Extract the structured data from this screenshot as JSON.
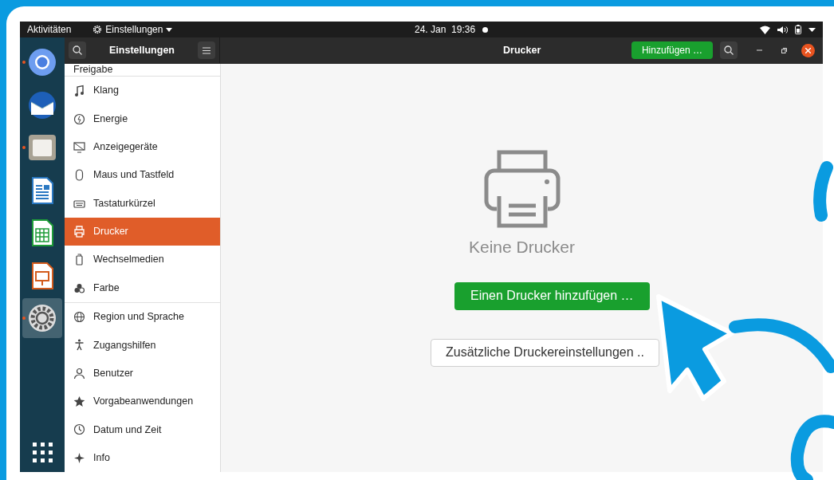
{
  "top_bar": {
    "activities": "Aktivitäten",
    "app_menu": "Einstellungen",
    "clock": "24. Jan  19:36",
    "notification": true
  },
  "dock": [
    {
      "kind": "browser",
      "running": true,
      "selected": false
    },
    {
      "kind": "mail",
      "running": false,
      "selected": false
    },
    {
      "kind": "files",
      "running": true,
      "selected": false
    },
    {
      "kind": "writer",
      "running": false,
      "selected": false
    },
    {
      "kind": "calc",
      "running": false,
      "selected": false
    },
    {
      "kind": "impress",
      "running": false,
      "selected": false
    },
    {
      "kind": "settings",
      "running": true,
      "selected": true
    }
  ],
  "header": {
    "sidebar_title": "Einstellungen",
    "page_title": "Drucker",
    "add_button": "Hinzufügen …"
  },
  "sidebar": {
    "groups": [
      [
        {
          "label": "Freigabe",
          "selected": false
        }
      ],
      [
        {
          "label": "Klang",
          "selected": false
        },
        {
          "label": "Energie",
          "selected": false
        },
        {
          "label": "Anzeigegeräte",
          "selected": false
        },
        {
          "label": "Maus und Tastfeld",
          "selected": false
        },
        {
          "label": "Tastaturkürzel",
          "selected": false
        },
        {
          "label": "Drucker",
          "selected": true
        },
        {
          "label": "Wechselmedien",
          "selected": false
        },
        {
          "label": "Farbe",
          "selected": false
        }
      ],
      [
        {
          "label": "Region und Sprache",
          "selected": false
        },
        {
          "label": "Zugangshilfen",
          "selected": false
        },
        {
          "label": "Benutzer",
          "selected": false
        },
        {
          "label": "Vorgabeanwendungen",
          "selected": false
        },
        {
          "label": "Datum und Zeit",
          "selected": false
        },
        {
          "label": "Info",
          "selected": false
        }
      ]
    ]
  },
  "content": {
    "empty_title": "Keine Drucker",
    "primary_button": "Einen Drucker hinzufügen …",
    "secondary_button": "Zusätzliche Druckereinstellungen .."
  }
}
